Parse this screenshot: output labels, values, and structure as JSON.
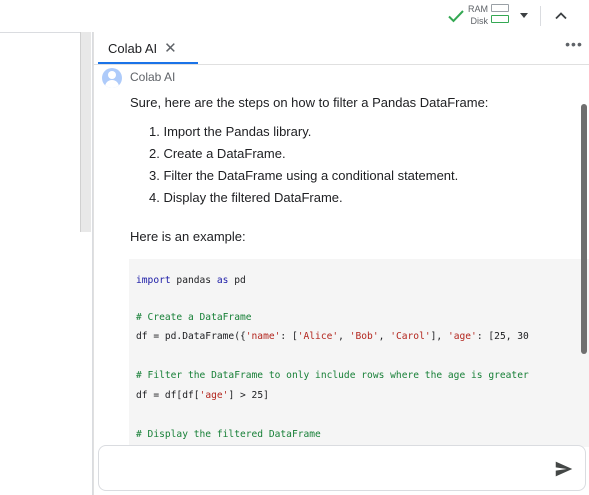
{
  "resources": {
    "ram_label": "RAM",
    "disk_label": "Disk"
  },
  "panel": {
    "tab_label": "Colab AI",
    "tab_close": "✕",
    "more_icon": "•••",
    "sender": "Colab AI",
    "intro": "Sure, here are the steps on how to filter a Pandas DataFrame:",
    "steps": [
      "1. Import the Pandas library.",
      "2. Create a DataFrame.",
      "3. Filter the DataFrame using a conditional statement.",
      "4. Display the filtered DataFrame."
    ],
    "example_label": "Here is an example:",
    "code": {
      "line1": {
        "kw1": "import",
        "mid": " pandas ",
        "kw2": "as",
        "tail": " pd"
      },
      "comment1": "# Create a DataFrame",
      "line2": {
        "a": "df = pd.DataFrame({",
        "s1": "'name'",
        "b": ": [",
        "s2": "'Alice'",
        "c": ", ",
        "s3": "'Bob'",
        "d": ", ",
        "s4": "'Carol'",
        "e": "], ",
        "s5": "'age'",
        "f": ": [25, 30"
      },
      "comment2": "# Filter the DataFrame to only include rows where the age is greater",
      "line3": {
        "a": "df = df[df[",
        "s1": "'age'",
        "b": "] > 25]"
      },
      "comment3": "# Display the filtered DataFrame"
    },
    "input_placeholder": ""
  },
  "colors": {
    "accent": "#1a73e8",
    "check": "#34a853",
    "code_bg": "#f5f5f5",
    "keyword": "#1a1aa6",
    "comment": "#188038",
    "string": "#b3261e"
  },
  "icons": {
    "status": "check-icon",
    "dropdown": "caret-down-icon",
    "collapse": "chevron-up-icon",
    "avatar": "person-avatar-icon",
    "menu": "more-horizontal-icon",
    "send": "send-icon"
  }
}
